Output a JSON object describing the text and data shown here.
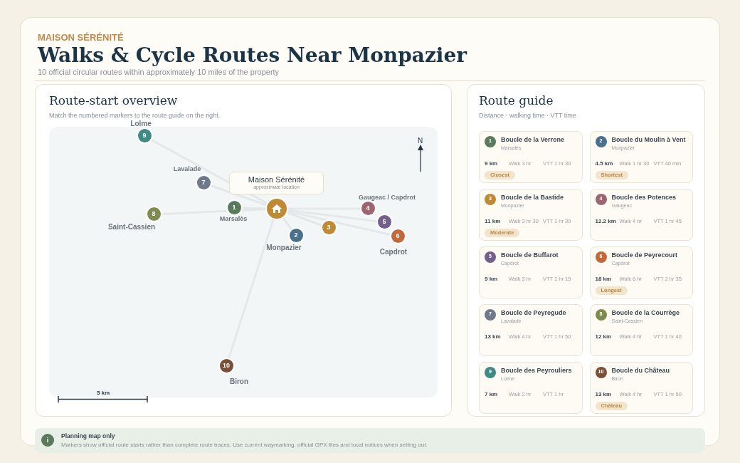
{
  "header": {
    "brand": "MAISON SÉRÉNITÉ",
    "title": "Walks & Cycle Routes Near Monpazier",
    "subtitle": "10 official circular routes within approximately 10 miles of the property"
  },
  "overview": {
    "title": "Route-start overview",
    "subtitle": "Match the numbered markers to the route guide on the right.",
    "map": {
      "north": "N",
      "scale": "5 km",
      "home": {
        "name": "Maison Sérénité",
        "note": "approximate location"
      },
      "places": [
        "Lolme",
        "Lavalade",
        "Marsalès",
        "Saint-Cassien",
        "Monpazier",
        "Gaugeac / Capdrot",
        "Capdrot",
        "Biron"
      ],
      "markers": [
        {
          "number": "1",
          "color": "#5a7a5e"
        },
        {
          "number": "2",
          "color": "#4a7090"
        },
        {
          "number": "3",
          "color": "#c08a35"
        },
        {
          "number": "4",
          "color": "#9c6670"
        },
        {
          "number": "5",
          "color": "#735f8c"
        },
        {
          "number": "6",
          "color": "#c0693a"
        },
        {
          "number": "7",
          "color": "#6e7a8a"
        },
        {
          "number": "8",
          "color": "#7d8a50"
        },
        {
          "number": "9",
          "color": "#3f8a85"
        },
        {
          "number": "10",
          "color": "#7a4f35"
        }
      ]
    }
  },
  "guide": {
    "title": "Route guide",
    "subtitle": "Distance · walking time · VTT time",
    "routes": [
      {
        "number": "1",
        "color": "#5a7a5e",
        "name": "Boucle de la Verrone",
        "place": "Marsalès",
        "distance": "9 km",
        "walk": "Walk 3 hr",
        "vtt": "VTT 1 hr 30",
        "tag": "Closest"
      },
      {
        "number": "2",
        "color": "#4a7090",
        "name": "Boucle du Moulin à Vent",
        "place": "Monpazier",
        "distance": "4.5 km",
        "walk": "Walk 1 hr 30",
        "vtt": "VTT 40 min",
        "tag": "Shortest"
      },
      {
        "number": "3",
        "color": "#c08a35",
        "name": "Boucle de la Bastide",
        "place": "Monpazier",
        "distance": "11 km",
        "walk": "Walk 3 hr 30",
        "vtt": "VTT 1 hr 30",
        "tag": "Moderate"
      },
      {
        "number": "4",
        "color": "#9c6670",
        "name": "Boucle des Potences",
        "place": "Gaugeac",
        "distance": "12.2 km",
        "walk": "Walk 4 hr",
        "vtt": "VTT 1 hr 45"
      },
      {
        "number": "5",
        "color": "#735f8c",
        "name": "Boucle de Buffarot",
        "place": "Capdrot",
        "distance": "9 km",
        "walk": "Walk 3 hr",
        "vtt": "VTT 1 hr 15"
      },
      {
        "number": "6",
        "color": "#c0693a",
        "name": "Boucle de Peyrecourt",
        "place": "Capdrot",
        "distance": "18 km",
        "walk": "Walk 6 hr",
        "vtt": "VTT 2 hr 35",
        "tag": "Longest"
      },
      {
        "number": "7",
        "color": "#6e7a8a",
        "name": "Boucle de Peyregude",
        "place": "Lavalade",
        "distance": "13 km",
        "walk": "Walk 4 hr",
        "vtt": "VTT 1 hr 50"
      },
      {
        "number": "8",
        "color": "#7d8a50",
        "name": "Boucle de la Courrège",
        "place": "Saint-Cassien",
        "distance": "12 km",
        "walk": "Walk 4 hr",
        "vtt": "VTT 1 hr 40"
      },
      {
        "number": "9",
        "color": "#3f8a85",
        "name": "Boucle des Peyrouliers",
        "place": "Loime",
        "distance": "7 km",
        "walk": "Walk 2 hr",
        "vtt": "VTT 1 hr"
      },
      {
        "number": "10",
        "color": "#7a4f35",
        "name": "Boucle du Château",
        "place": "Biron",
        "distance": "13 km",
        "walk": "Walk 4 hr",
        "vtt": "VTT 1 hr 50",
        "tag": "Château"
      }
    ]
  },
  "note": {
    "icon": "i",
    "title": "Planning map only",
    "text": "Markers show official route starts rather than complete route traces. Use current waymarking, official GPX files and local notices when setting out."
  }
}
